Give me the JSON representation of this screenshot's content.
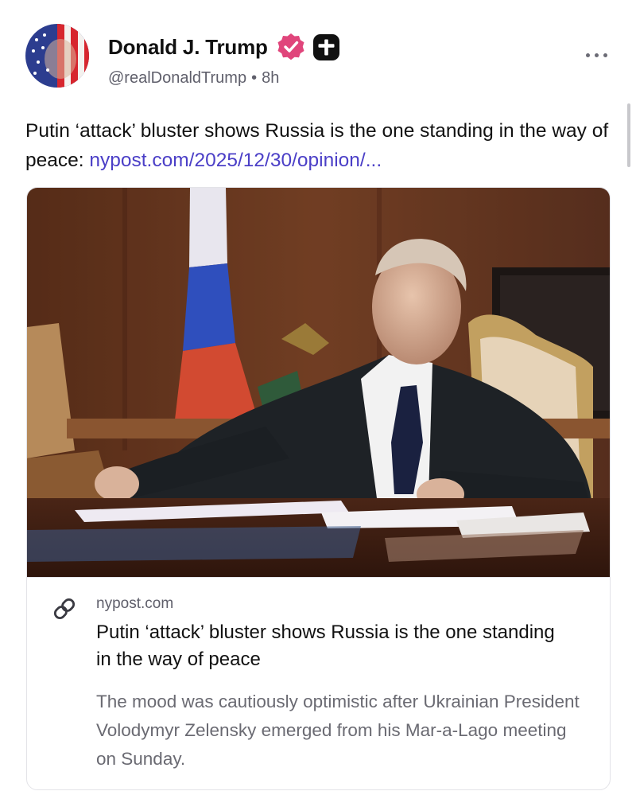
{
  "author": {
    "name": "Donald J. Trump",
    "handle": "@realDonaldTrump",
    "separator": "•",
    "time": "8h",
    "verified_icon": "verified-badge-icon",
    "plus_icon": "plus-icon"
  },
  "post": {
    "text": "Putin ‘attack’ bluster shows Russia is the one standing in the way of peace: ",
    "link_text": "nypost.com/2025/12/30/opinion/..."
  },
  "card": {
    "domain": "nypost.com",
    "title": "Putin ‘attack’ bluster shows Russia is the one standing in the way of peace",
    "description": "The mood was cautiously optimistic after Ukrainian President Volodymyr Zelensky emerged from his Mar-a-Lago meeting on Sunday.",
    "link_icon": "link-icon"
  },
  "colors": {
    "link": "#4b3fc7",
    "verified": "#e0457b",
    "muted": "#5f5f6b"
  }
}
